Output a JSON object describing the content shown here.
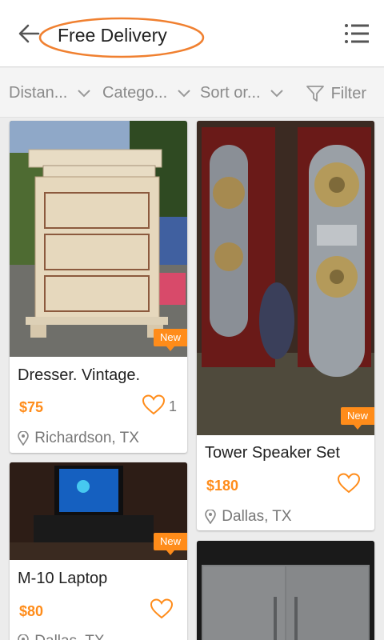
{
  "header": {
    "title": "Free Delivery",
    "accent": "#ff8c1a",
    "highlight_ring_color": "#f08030"
  },
  "filters": {
    "distance": "Distan...",
    "category": "Catego...",
    "sort": "Sort or...",
    "filter": "Filter"
  },
  "listings": [
    {
      "title": "Dresser. Vintage.",
      "price": "$75",
      "likes": "1",
      "location": "Richardson, TX",
      "badge": "New"
    },
    {
      "title": "Tower Speaker Set",
      "price": "$180",
      "likes": "",
      "location": "Dallas, TX",
      "badge": "New"
    },
    {
      "title": "M-10 Laptop",
      "price": "$80",
      "likes": "",
      "location": "Dallas, TX",
      "badge": "New"
    },
    {
      "title": "",
      "price": "",
      "likes": "",
      "location": "",
      "badge": ""
    }
  ]
}
